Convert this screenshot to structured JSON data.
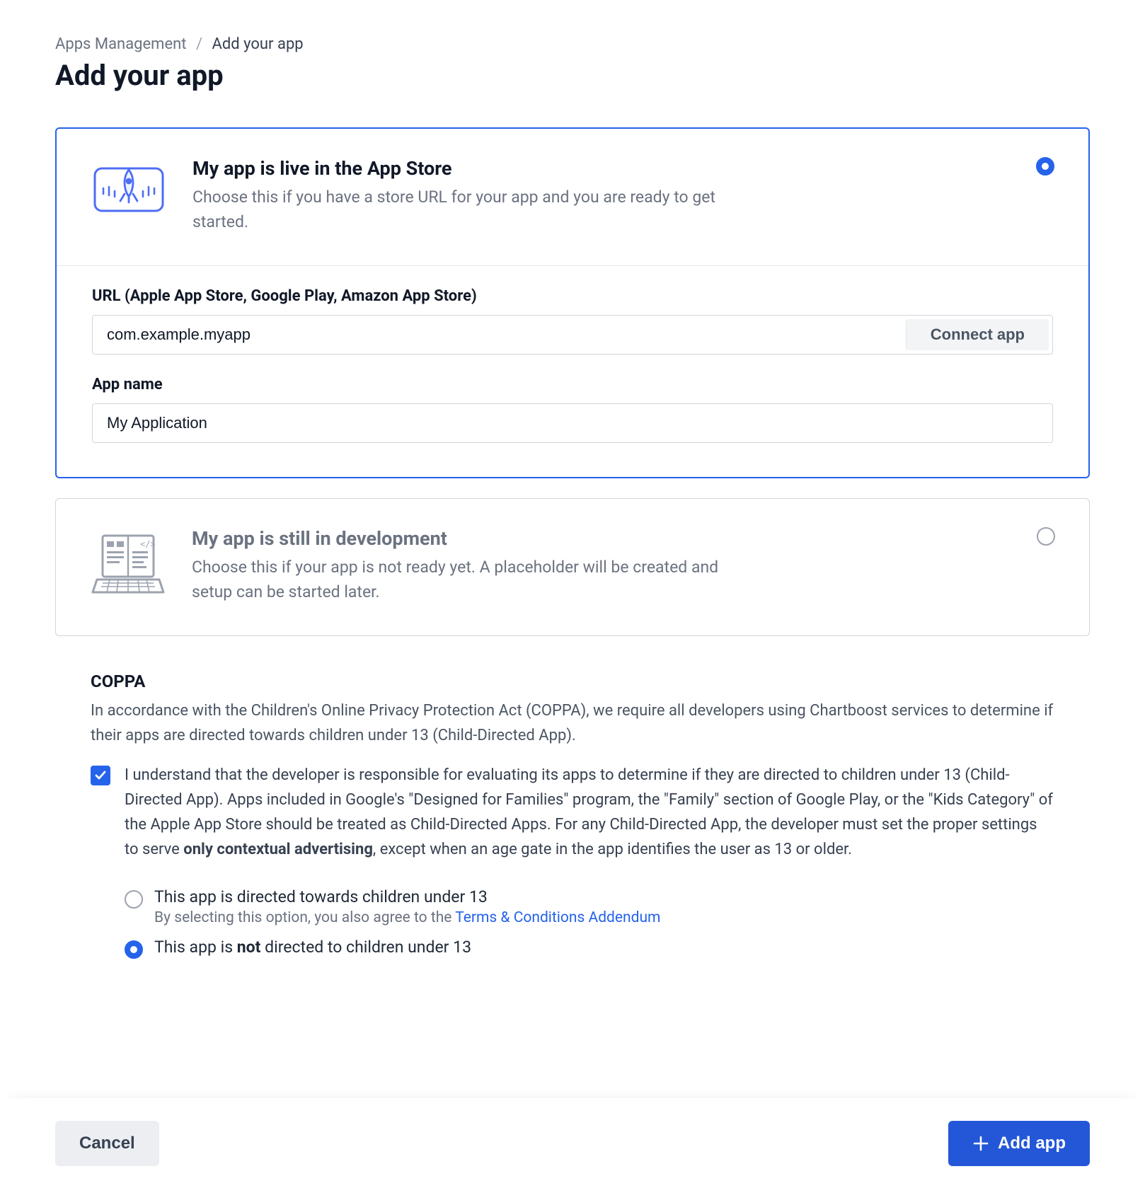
{
  "breadcrumb": {
    "root": "Apps Management",
    "separator": "/",
    "current": "Add your app"
  },
  "page_title": "Add your app",
  "options": {
    "live": {
      "title": "My app is live in the App Store",
      "desc": "Choose this if you have a store URL for your app and you are ready to get started.",
      "selected": true,
      "url_label": "URL (Apple App Store, Google Play, Amazon App Store)",
      "url_value": "com.example.myapp",
      "connect_label": "Connect app",
      "name_label": "App name",
      "name_value": "My Application"
    },
    "dev": {
      "title": "My app is still in development",
      "desc": "Choose this if your app is not ready yet. A placeholder will be created and setup can be started later.",
      "selected": false
    }
  },
  "coppa": {
    "heading": "COPPA",
    "intro": "In accordance with the Children's Online Privacy Protection Act (COPPA), we require all developers using Chartboost services to determine if their apps are directed towards children under 13 (Child-Directed App).",
    "consent_pre": "I understand that the developer is responsible for evaluating its apps to determine if they are directed to children under 13 (Child-Directed App). Apps included in Google's \"Designed for Families\" program, the \"Family\" section of Google Play, or the \"Kids Category\" of the Apple App Store should be treated as Child-Directed Apps. For any Child-Directed App, the developer must set the proper settings to serve ",
    "consent_bold": "only contextual advertising",
    "consent_post": ", except when an age gate in the app identifies the user as 13 or older.",
    "consent_checked": true,
    "option_directed": {
      "label": "This app is directed towards children under 13",
      "note_prefix": "By selecting this option, you also agree to the ",
      "note_link": "Terms & Conditions Addendum",
      "selected": false
    },
    "option_not_directed": {
      "prefix": "This app is ",
      "bold": "not",
      "suffix": " directed to children under 13",
      "selected": true
    }
  },
  "footer": {
    "cancel": "Cancel",
    "add": "Add app"
  }
}
